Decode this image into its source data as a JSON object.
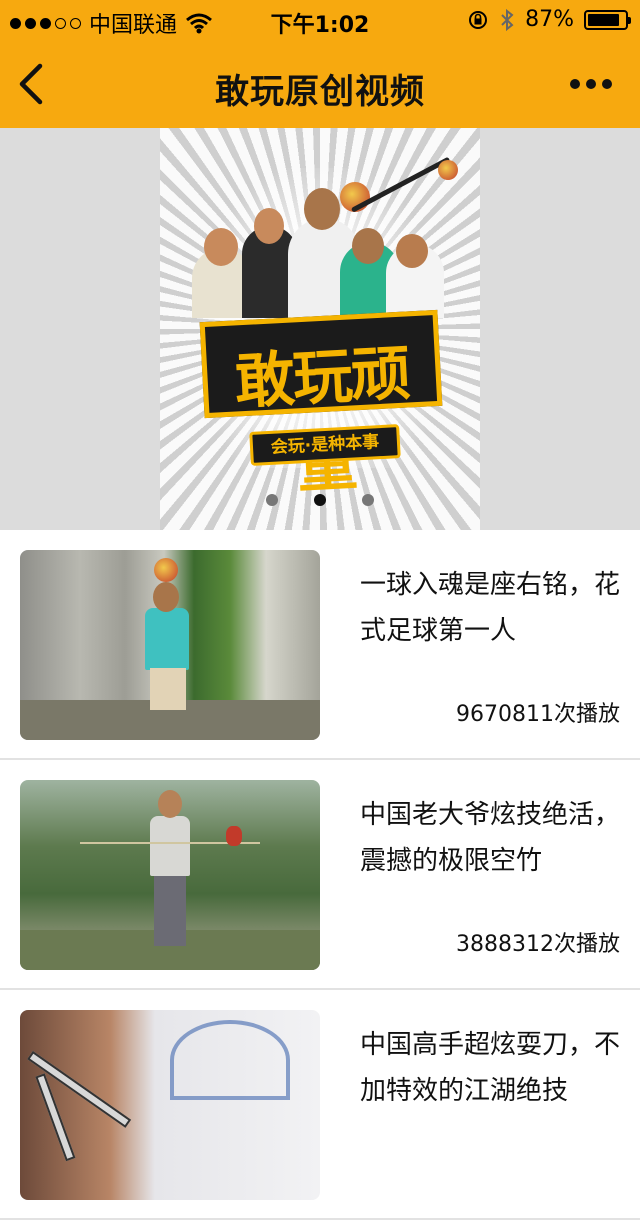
{
  "status_bar": {
    "signal_dots": [
      true,
      true,
      true,
      false,
      false
    ],
    "carrier": "中国联通",
    "time": "下午1:02",
    "battery": "87%",
    "battery_level": 0.87,
    "icons": [
      "wifi-icon",
      "rotation-lock-icon",
      "bluetooth-icon",
      "battery-icon"
    ]
  },
  "nav": {
    "title": "敢玩原创视频",
    "back_icon": "chevron-left-icon",
    "more_icon": "more-dots-icon"
  },
  "banner": {
    "logo_text": "敢玩顽童",
    "slogan": "会玩·是种本事",
    "pages": 3,
    "active_page": 2
  },
  "videos": [
    {
      "title": "一球入魂是座右铭，花式足球第一人",
      "plays": "9670811次播放"
    },
    {
      "title": "中国老大爷炫技绝活，震撼的极限空竹",
      "plays": "3888312次播放"
    },
    {
      "title": "中国高手超炫耍刀，不加特效的江湖绝技",
      "plays": ""
    }
  ],
  "colors": {
    "header": "#f7a90f",
    "banner_bg": "#dcdcdc",
    "logo_yellow": "#f5b400",
    "divider": "#e2e2e2"
  }
}
